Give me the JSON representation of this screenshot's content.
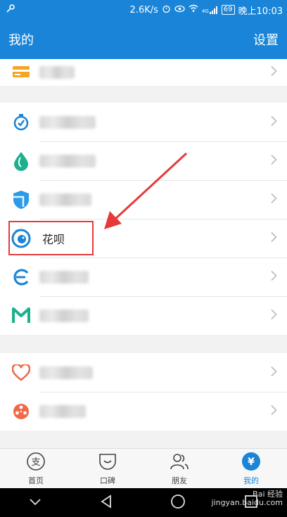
{
  "status_bar": {
    "speed": "2.6K/s",
    "network": "4G",
    "battery": "69",
    "time": "晚上10:03"
  },
  "header": {
    "title": "我的",
    "settings": "设置"
  },
  "items": {
    "huabei": "花呗"
  },
  "tabs": [
    {
      "label": "首页",
      "icon": "zhi-icon"
    },
    {
      "label": "口碑",
      "icon": "koubei-icon"
    },
    {
      "label": "朋友",
      "icon": "friends-icon"
    },
    {
      "label": "我的",
      "icon": "yen-icon"
    }
  ],
  "watermark": {
    "line1": "Bai 经验",
    "line2": "jingyan.baidu.com"
  },
  "colors": {
    "accent": "#1a85d8",
    "highlight": "#e63a3a"
  }
}
